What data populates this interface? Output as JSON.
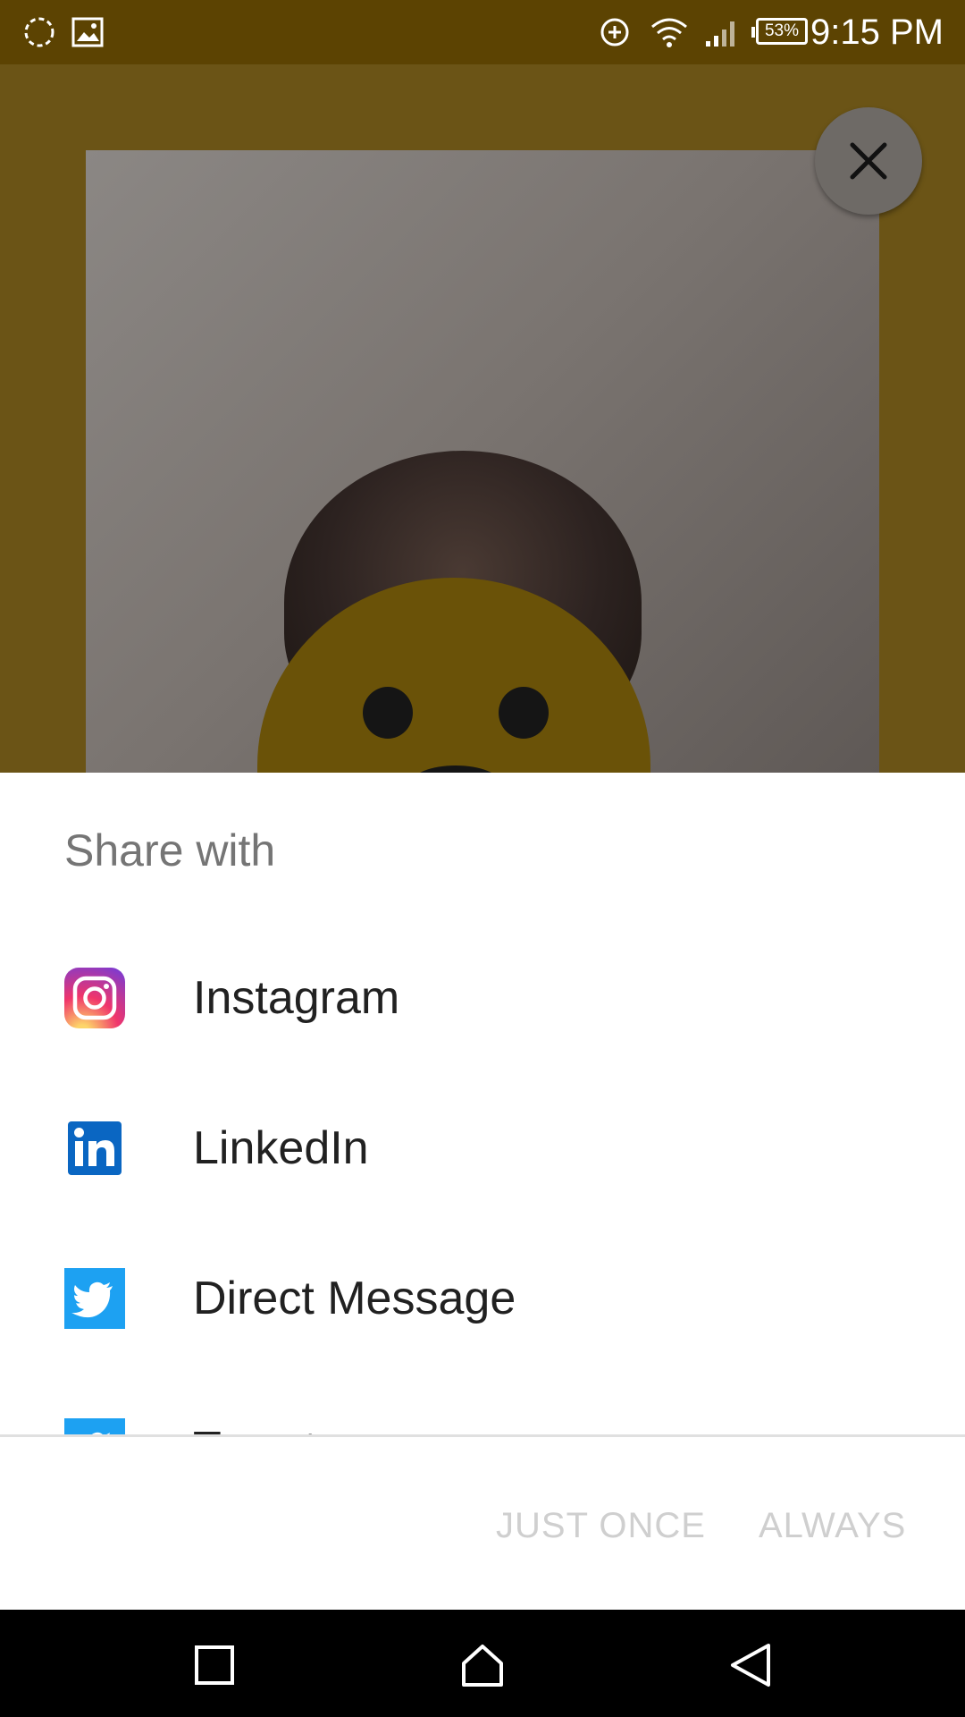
{
  "status_bar": {
    "time": "9:15 PM",
    "battery": "53%",
    "icons": [
      "sync-icon",
      "image-icon",
      "data-saver-icon",
      "wifi-icon",
      "signal-icon",
      "battery-icon"
    ]
  },
  "preview": {
    "close_icon": "close-icon"
  },
  "share_sheet": {
    "title": "Share with",
    "apps": [
      {
        "label": "Instagram",
        "icon": "instagram-icon"
      },
      {
        "label": "LinkedIn",
        "icon": "linkedin-icon"
      },
      {
        "label": "Direct Message",
        "icon": "twitter-icon"
      },
      {
        "label": "Tweet",
        "icon": "twitter-icon"
      }
    ],
    "actions": {
      "just_once": "JUST ONCE",
      "always": "ALWAYS"
    }
  },
  "nav_bar": {
    "icons": [
      "recents-icon",
      "home-icon",
      "back-icon"
    ]
  },
  "colors": {
    "status_bar": "#5c4302",
    "overlay": "#6b5416",
    "twitter": "#1da1f2",
    "linkedin": "#0a66c2",
    "disabled_action": "#cfcfcf"
  }
}
